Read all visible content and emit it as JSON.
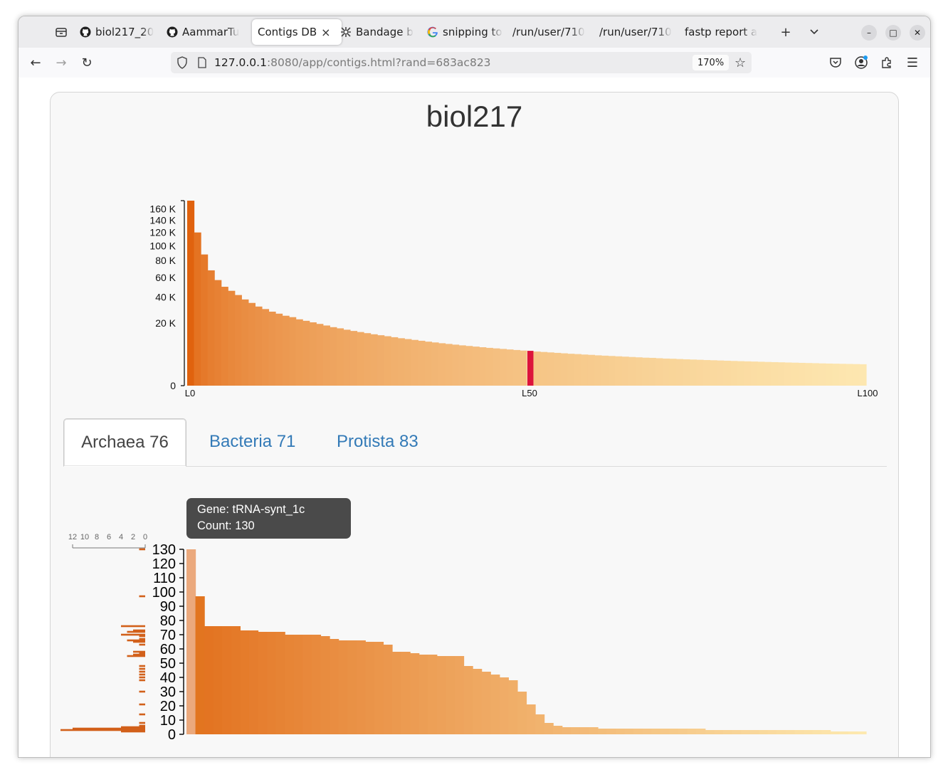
{
  "browser": {
    "tabs": [
      {
        "label": "biol217_20",
        "icon": "github-icon",
        "active": false
      },
      {
        "label": "AammarTu",
        "icon": "github-icon",
        "active": false
      },
      {
        "label": "Contigs DB",
        "icon": "",
        "active": true
      },
      {
        "label": "Bandage b",
        "icon": "bandage-icon",
        "active": false
      },
      {
        "label": "snipping to",
        "icon": "google-icon",
        "active": false
      },
      {
        "label": "/run/user/710",
        "icon": "",
        "active": false
      },
      {
        "label": "/run/user/710",
        "icon": "",
        "active": false
      },
      {
        "label": "fastp report a",
        "icon": "",
        "active": false
      }
    ],
    "url_host": "127.0.0.1",
    "url_rest": ":8080/app/contigs.html?rand=683ac823",
    "zoom": "170%"
  },
  "page": {
    "title": "biol217"
  },
  "n_chart": {
    "y_ticks": [
      "160 K",
      "140 K",
      "120 K",
      "100 K",
      "80 K",
      "60 K",
      "40 K",
      "20 K",
      "0"
    ],
    "x_labels": [
      "L0",
      "L50",
      "L100"
    ],
    "highlight_index": 50,
    "highlight_color": "#dc143c",
    "gradient_dark": "#e0620e",
    "gradient_light": "#fde7b0"
  },
  "group_tabs": [
    {
      "label": "Archaea 76",
      "active": true
    },
    {
      "label": "Bacteria 71",
      "active": false
    },
    {
      "label": "Protista 83",
      "active": false
    }
  ],
  "tooltip": {
    "line1": "Gene: tRNA-synt_1c",
    "line2": "Count: 130"
  },
  "hist_axis": {
    "labels": [
      "12",
      "10",
      "8",
      "6",
      "4",
      "2",
      "0"
    ]
  },
  "chart_data": [
    {
      "type": "bar",
      "title": "",
      "xlabel": "",
      "ylabel": "",
      "y_scale": "sqrt",
      "ylim": [
        0,
        175000
      ],
      "x_tick_labels": [
        "L0",
        "L50",
        "L100"
      ],
      "values": [
        175000,
        120000,
        88000,
        68000,
        57000,
        50000,
        46000,
        42000,
        38000,
        35000,
        32000,
        30000,
        28000,
        26500,
        25000,
        24000,
        22500,
        21500,
        20500,
        19500,
        18500,
        17500,
        16800,
        16000,
        15300,
        14700,
        14100,
        13500,
        13000,
        12500,
        12000,
        11500,
        11100,
        10700,
        10300,
        9900,
        9550,
        9200,
        8900,
        8600,
        8300,
        8050,
        7800,
        7550,
        7300,
        7100,
        6900,
        6700,
        6500,
        6300,
        6200,
        5950,
        5800,
        5650,
        5500,
        5350,
        5200,
        5100,
        4950,
        4850,
        4700,
        4600,
        4500,
        4400,
        4300,
        4200,
        4100,
        4000,
        3950,
        3850,
        3750,
        3700,
        3620,
        3550,
        3480,
        3420,
        3350,
        3300,
        3240,
        3180,
        3120,
        3070,
        3020,
        2970,
        2920,
        2870,
        2830,
        2790,
        2740,
        2700,
        2660,
        2620,
        2580,
        2540,
        2500,
        2470,
        2440,
        2410,
        2380,
        2350
      ],
      "highlight": {
        "index": 50,
        "label": "L50"
      }
    },
    {
      "type": "bar",
      "title": "",
      "xlabel": "",
      "ylabel": "",
      "ylim": [
        0,
        130
      ],
      "y_ticks": [
        0,
        10,
        20,
        30,
        40,
        50,
        60,
        70,
        80,
        90,
        100,
        110,
        120,
        130
      ],
      "values": [
        130,
        97,
        76,
        76,
        76,
        76,
        73,
        73,
        72,
        72,
        72,
        70,
        70,
        70,
        70,
        69,
        67,
        66,
        66,
        66,
        65,
        65,
        63,
        58,
        58,
        57,
        56,
        56,
        55,
        55,
        55,
        48,
        46,
        44,
        42,
        40,
        38,
        30,
        21,
        14,
        8,
        6,
        5,
        5,
        5,
        5,
        4,
        4,
        4,
        4,
        4,
        4,
        4,
        4,
        4,
        4,
        4,
        4,
        3,
        3,
        3,
        3,
        3,
        3,
        3,
        3,
        3,
        3,
        3,
        3,
        3,
        3,
        2,
        2,
        2,
        2
      ],
      "highlight": {
        "index": 0,
        "gene": "tRNA-synt_1c",
        "count": 130
      }
    },
    {
      "type": "bar",
      "orientation": "horizontal",
      "title": "",
      "xlim": [
        0,
        12
      ],
      "x_tick_labels": [
        "12",
        "10",
        "8",
        "6",
        "4",
        "2",
        "0"
      ],
      "bars": [
        {
          "y": 130,
          "count": 1
        },
        {
          "y": 97,
          "count": 1
        },
        {
          "y": 76,
          "count": 4
        },
        {
          "y": 73,
          "count": 2
        },
        {
          "y": 72,
          "count": 3
        },
        {
          "y": 70,
          "count": 4
        },
        {
          "y": 69,
          "count": 1
        },
        {
          "y": 67,
          "count": 1
        },
        {
          "y": 66,
          "count": 3
        },
        {
          "y": 65,
          "count": 2
        },
        {
          "y": 63,
          "count": 1
        },
        {
          "y": 58,
          "count": 2
        },
        {
          "y": 57,
          "count": 1
        },
        {
          "y": 56,
          "count": 2
        },
        {
          "y": 55,
          "count": 3
        },
        {
          "y": 48,
          "count": 1
        },
        {
          "y": 46,
          "count": 1
        },
        {
          "y": 44,
          "count": 1
        },
        {
          "y": 42,
          "count": 1
        },
        {
          "y": 40,
          "count": 1
        },
        {
          "y": 38,
          "count": 1
        },
        {
          "y": 30,
          "count": 1
        },
        {
          "y": 21,
          "count": 1
        },
        {
          "y": 14,
          "count": 1
        },
        {
          "y": 8,
          "count": 1
        },
        {
          "y": 6,
          "count": 1
        },
        {
          "y": 5,
          "count": 4
        },
        {
          "y": 4,
          "count": 12
        },
        {
          "y": 3,
          "count": 14
        },
        {
          "y": 2,
          "count": 4
        }
      ]
    }
  ]
}
